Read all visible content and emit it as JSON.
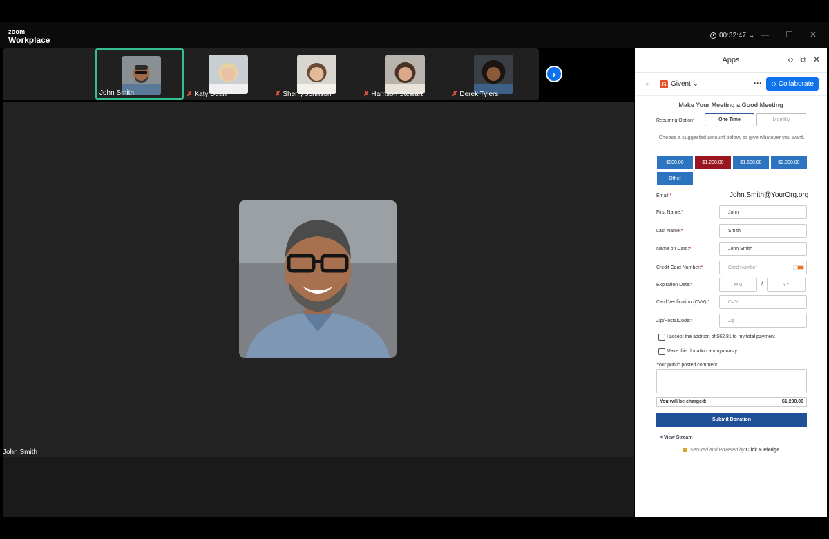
{
  "titlebar": {
    "logo_line1": "zoom",
    "logo_line2": "Workplace",
    "timer": "00:32:47"
  },
  "participants": [
    {
      "name": "John Smith",
      "muted": false,
      "active": true
    },
    {
      "name": "Katy Dean",
      "muted": true,
      "active": false
    },
    {
      "name": "Sherry Johnson",
      "muted": true,
      "active": false
    },
    {
      "name": "Harrison Stewart",
      "muted": true,
      "active": false
    },
    {
      "name": "Derek Tylers",
      "muted": true,
      "active": false
    }
  ],
  "stage": {
    "speaker_name": "John Smith"
  },
  "panel": {
    "title": "Apps",
    "app_name": "Givent",
    "collaborate_label": "Collaborate"
  },
  "form": {
    "title": "Make Your Meeting a Good Meeting",
    "recurring_label": "Recurring Option",
    "recurring_options": [
      "One Time",
      "Monthly"
    ],
    "suggest_text": "Choose a suggested amount below, or give whatever you want.",
    "amounts": [
      "$800.00",
      "$1,200.00",
      "$1,600.00",
      "$2,000.00",
      "Other"
    ],
    "selected_amount": "$1,200.00",
    "email_label": "Email:",
    "email_value": "John.Smith@YourOrg.org",
    "first_name_label": "First Name:",
    "first_name_value": "John",
    "last_name_label": "Last Name:",
    "last_name_value": "Smith",
    "name_on_card_label": "Name on Card:",
    "name_on_card_value": "John Smith",
    "card_number_label": "Credit Card Number:",
    "card_number_placeholder": "Card Number",
    "expiration_label": "Expiration Date:",
    "mm_placeholder": "MM",
    "yy_placeholder": "YY",
    "cvv_label": "Card Verification (CVV):",
    "cvv_placeholder": "CVV",
    "zip_label": "Zip/PostalCode:",
    "zip_placeholder": "Zip",
    "accept_fee_label": "I accept the addition of $62.81 to my total payment",
    "anonymous_label": "Make this donation anonymously",
    "comment_label": "Your public posted comment:",
    "charge_label": "You will be charged:",
    "charge_amount": "$1,200.00",
    "submit_label": "Submit Donation",
    "view_stream": "< View Stream",
    "secured_text": "Secured and Powered by",
    "secured_brand": "Click & Pledge"
  },
  "colors": {
    "zoom_blue": "#0e72ed",
    "active_border": "#35c08e",
    "amount_blue": "#2d74c0",
    "amount_selected": "#9b1520",
    "submit_blue": "#1f4f96"
  }
}
